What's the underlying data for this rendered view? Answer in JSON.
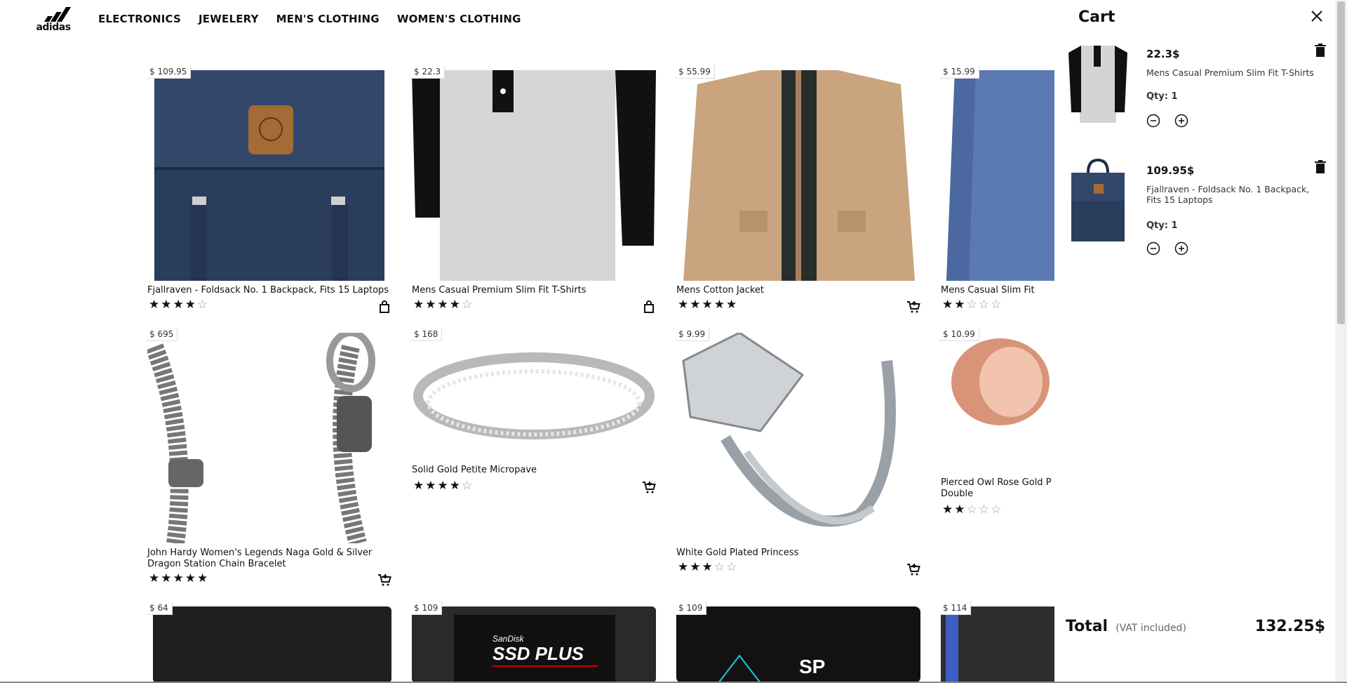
{
  "brand": {
    "name": "adidas"
  },
  "nav": [
    "ELECTRONICS",
    "JEWELERY",
    "MEN'S CLOTHING",
    "WOMEN'S CLOTHING"
  ],
  "products": [
    {
      "price": "$ 109.95",
      "title": "Fjallraven - Foldsack No. 1 Backpack, Fits 15 Laptops",
      "rating": 4,
      "action_icon": "bag-icon"
    },
    {
      "price": "$ 22.3",
      "title": "Mens Casual Premium Slim Fit T-Shirts",
      "rating": 4,
      "action_icon": "bag-icon"
    },
    {
      "price": "$ 55.99",
      "title": "Mens Cotton Jacket",
      "rating": 5,
      "action_icon": "add-to-cart-icon"
    },
    {
      "price": "$ 15.99",
      "title": "Mens Casual Slim Fit",
      "rating": 2,
      "action_icon": "add-to-cart-icon"
    },
    {
      "price": "$ 695",
      "title": "John Hardy Women's Legends Naga Gold & Silver Dragon Station Chain Bracelet",
      "rating": 5,
      "action_icon": "add-to-cart-icon"
    },
    {
      "price": "$ 168",
      "title": "Solid Gold Petite Micropave",
      "rating": 4,
      "action_icon": "add-to-cart-icon"
    },
    {
      "price": "$ 9.99",
      "title": "White Gold Plated Princess",
      "rating": 3,
      "action_icon": "add-to-cart-icon"
    },
    {
      "price": "$ 10.99",
      "title": "Pierced Owl Rose Gold P Double",
      "rating": 2,
      "action_icon": "add-to-cart-icon"
    },
    {
      "price": "$ 64",
      "title": "",
      "rating": 0,
      "action_icon": ""
    },
    {
      "price": "$ 109",
      "title": "",
      "rating": 0,
      "action_icon": "",
      "image_text": [
        "SanDisk",
        "SSD PLUS"
      ]
    },
    {
      "price": "$ 109",
      "title": "",
      "rating": 0,
      "action_icon": "",
      "image_text": [
        "SP"
      ]
    },
    {
      "price": "$ 114",
      "title": "",
      "rating": 0,
      "action_icon": ""
    }
  ],
  "cart": {
    "title": "Cart",
    "items": [
      {
        "price": "22.3$",
        "name": "Mens Casual Premium Slim Fit T-Shirts",
        "qty": "Qty: 1"
      },
      {
        "price": "109.95$",
        "name": "Fjallraven - Foldsack No. 1 Backpack, Fits 15 Laptops",
        "qty": "Qty: 1"
      }
    ],
    "total_label": "Total",
    "vat_note": "(VAT included)",
    "total_amount": "132.25$"
  }
}
